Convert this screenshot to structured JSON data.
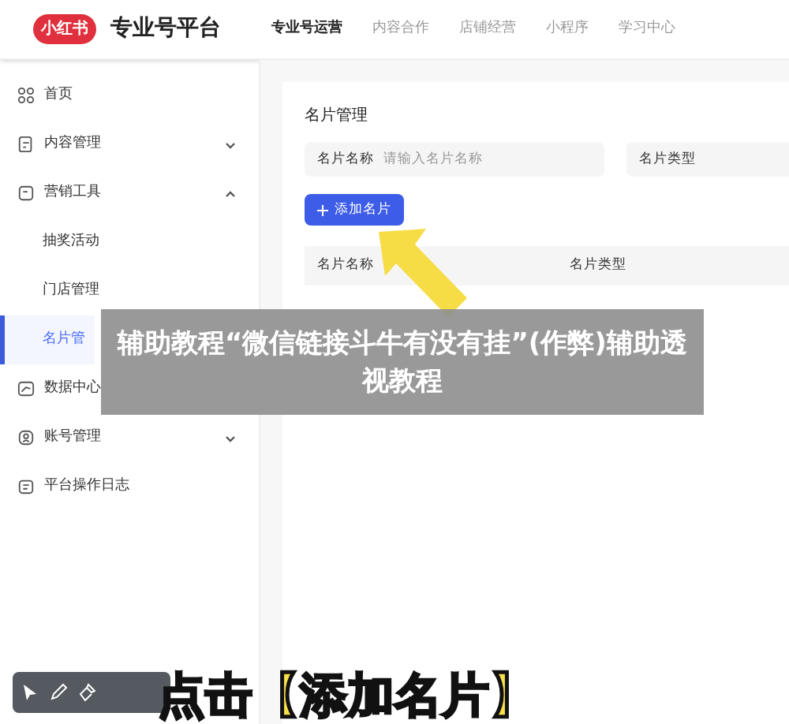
{
  "header": {
    "logo": "小红书",
    "title": "专业号平台",
    "nav": [
      {
        "label": "专业号运营",
        "selected": true
      },
      {
        "label": "内容合作",
        "selected": false
      },
      {
        "label": "店铺经营",
        "selected": false
      },
      {
        "label": "小程序",
        "selected": false
      },
      {
        "label": "学习中心",
        "selected": false
      }
    ]
  },
  "sidebar": {
    "items": [
      {
        "label": "首页",
        "kind": "grid"
      },
      {
        "label": "内容管理",
        "kind": "doc",
        "expanded": false
      },
      {
        "label": "营销工具",
        "kind": "tag",
        "expanded": true,
        "children": [
          {
            "label": "抽奖活动",
            "selected": false
          },
          {
            "label": "门店管理",
            "selected": false
          },
          {
            "label": "名片管",
            "selected": true
          }
        ]
      },
      {
        "label": "数据中心",
        "kind": "chart"
      },
      {
        "label": "账号管理",
        "kind": "user",
        "expanded": false
      },
      {
        "label": "平台操作日志",
        "kind": "log"
      }
    ]
  },
  "main": {
    "title": "名片管理",
    "filters": [
      {
        "label": "名片名称",
        "placeholder": "请输入名片名称"
      },
      {
        "label": "名片类型"
      }
    ],
    "add_button": "添加名片",
    "table": {
      "columns": [
        "名片名称",
        "名片类型"
      ]
    }
  },
  "overlay": {
    "banner": "辅助教程“微信链接斗牛有没有挂”(作弊)辅助透视教程",
    "caption": "点击【添加名片】"
  }
}
